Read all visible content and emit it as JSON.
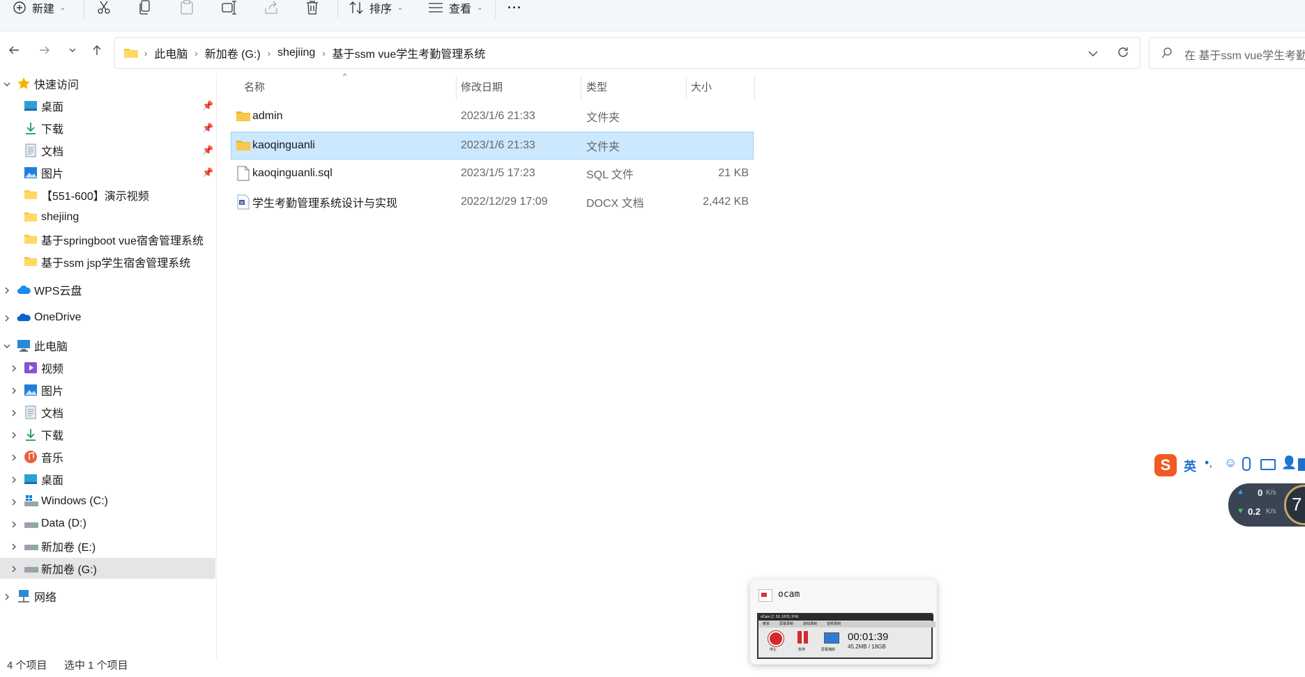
{
  "toolbar": {
    "new_label": "新建",
    "sort_label": "排序",
    "view_label": "查看",
    "more_label": "···"
  },
  "address": {
    "crumbs": [
      "此电脑",
      "新加卷 (G:)",
      "shejiing",
      "基于ssm vue学生考勤管理系统"
    ]
  },
  "search": {
    "placeholder": "在 基于ssm vue学生考勤管"
  },
  "sidebar": {
    "quick_access": "快速访问",
    "quick_items": [
      "桌面",
      "下载",
      "文档",
      "图片",
      "【551-600】演示视频",
      "shejiing",
      "基于springboot vue宿舍管理系统",
      "基于ssm jsp学生宿舍管理系统"
    ],
    "wps": "WPS云盘",
    "onedrive": "OneDrive",
    "this_pc": "此电脑",
    "pc_items": [
      "视频",
      "图片",
      "文档",
      "下载",
      "音乐",
      "桌面",
      "Windows (C:)",
      "Data (D:)",
      "新加卷 (E:)",
      "新加卷 (G:)"
    ],
    "network": "网络"
  },
  "columns": {
    "name": "名称",
    "date": "修改日期",
    "type": "类型",
    "size": "大小"
  },
  "files": [
    {
      "name": "admin",
      "date": "2023/1/6 21:33",
      "type": "文件夹",
      "size": ""
    },
    {
      "name": "kaoqinguanli",
      "date": "2023/1/6 21:33",
      "type": "文件夹",
      "size": ""
    },
    {
      "name": "kaoqinguanli.sql",
      "date": "2023/1/5 17:23",
      "type": "SQL 文件",
      "size": "21 KB"
    },
    {
      "name": "学生考勤管理系统设计与实现",
      "date": "2022/12/29 17:09",
      "type": "DOCX 文档",
      "size": "2,442 KB"
    }
  ],
  "status": {
    "count": "4 个项目",
    "selected": "选中 1 个项目"
  },
  "ocam": {
    "title": "ocam",
    "window_title": "oCam (7, 53, 1870, 974)",
    "tabs": [
      "菜单",
      "屏幕录制",
      "游戏录制",
      "音频录制"
    ],
    "stop_label": "停止",
    "pause_label": "暂停",
    "capture_label": "屏幕捕获",
    "time": "00:01:39",
    "size": "45.2MB / 18GB"
  },
  "ime": {
    "lang": "英"
  },
  "net": {
    "up": "0",
    "down": "0.2",
    "unit": "K/s",
    "badge": "7"
  },
  "colors": {
    "accent": "#0067c0",
    "selected_row": "#cce8ff",
    "folder": "#f8c84a"
  }
}
